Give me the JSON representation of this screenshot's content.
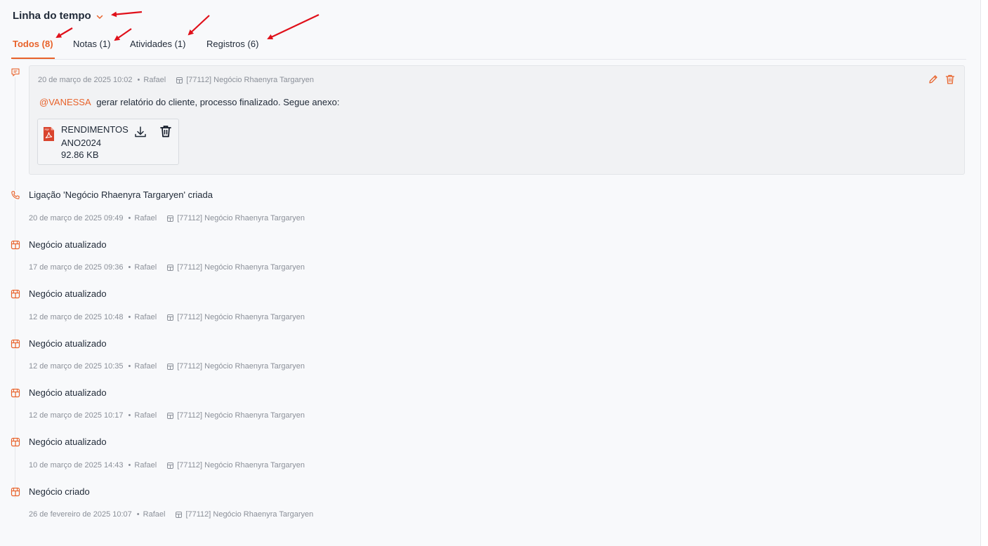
{
  "header": {
    "title": "Linha do tempo"
  },
  "tabs": [
    {
      "label": "Todos (8)"
    },
    {
      "label": "Notas (1)"
    },
    {
      "label": "Atividades (1)"
    },
    {
      "label": "Registros (6)"
    }
  ],
  "note": {
    "date": "20 de março de 2025 10:02",
    "author": "Rafael",
    "deal": "[77112] Negócio Rhaenyra Targaryen",
    "mention": "@VANESSA",
    "text": "gerar relatório do cliente, processo finalizado. Segue anexo:",
    "attachment": {
      "name": "RENDIMENTOS ANO2024",
      "size": "92.86 KB",
      "file_icon_label": "PDF"
    }
  },
  "events": [
    {
      "icon": "phone-icon",
      "title": "Ligação 'Negócio Rhaenyra Targaryen' criada",
      "date": "20 de março de 2025 09:49",
      "author": "Rafael",
      "deal": "[77112] Negócio Rhaenyra Targaryen"
    },
    {
      "icon": "deal-icon",
      "title": "Negócio atualizado",
      "date": "17 de março de 2025 09:36",
      "author": "Rafael",
      "deal": "[77112] Negócio Rhaenyra Targaryen"
    },
    {
      "icon": "deal-icon",
      "title": "Negócio atualizado",
      "date": "12 de março de 2025 10:48",
      "author": "Rafael",
      "deal": "[77112] Negócio Rhaenyra Targaryen"
    },
    {
      "icon": "deal-icon",
      "title": "Negócio atualizado",
      "date": "12 de março de 2025 10:35",
      "author": "Rafael",
      "deal": "[77112] Negócio Rhaenyra Targaryen"
    },
    {
      "icon": "deal-icon",
      "title": "Negócio atualizado",
      "date": "12 de março de 2025 10:17",
      "author": "Rafael",
      "deal": "[77112] Negócio Rhaenyra Targaryen"
    },
    {
      "icon": "deal-icon",
      "title": "Negócio atualizado",
      "date": "10 de março de 2025 14:43",
      "author": "Rafael",
      "deal": "[77112] Negócio Rhaenyra Targaryen"
    },
    {
      "icon": "deal-icon",
      "title": "Negócio criado",
      "date": "26 de fevereiro de 2025 10:07",
      "author": "Rafael",
      "deal": "[77112] Negócio Rhaenyra Targaryen"
    }
  ],
  "colors": {
    "accent": "#e8622a",
    "annotation_arrow": "#e0101a",
    "muted": "#8b9099",
    "card_bg": "#f1f2f4"
  },
  "meta_separator": "•"
}
